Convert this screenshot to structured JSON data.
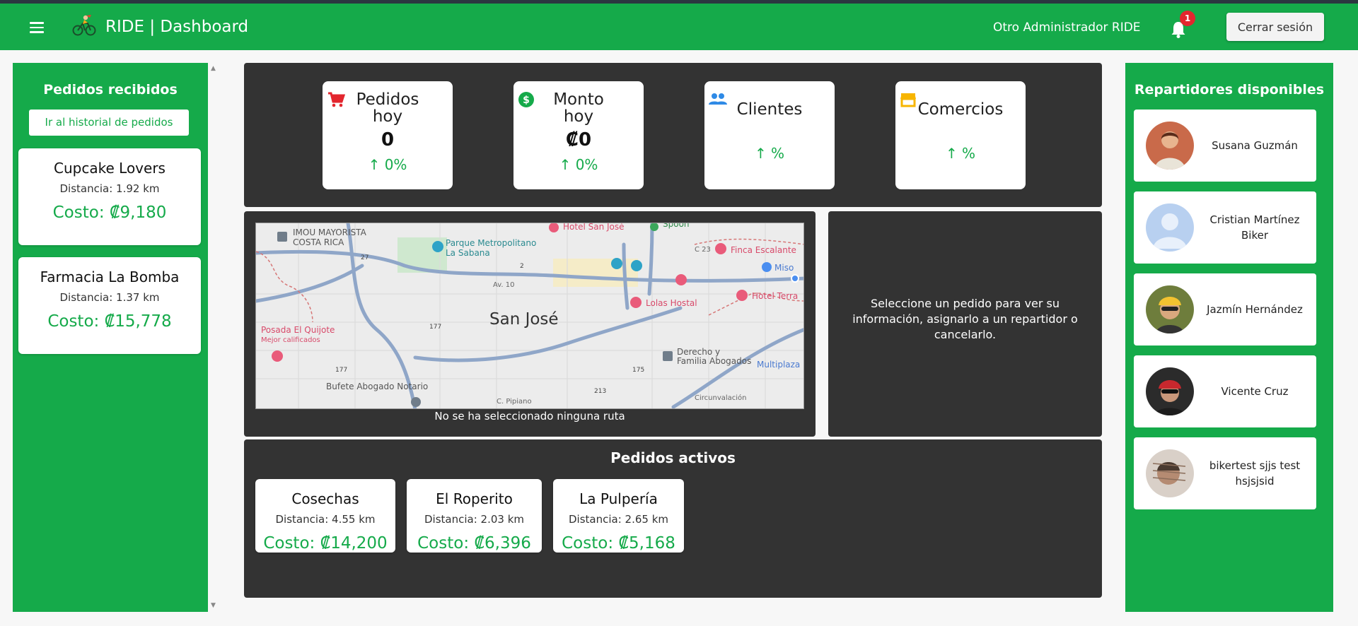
{
  "header": {
    "title": "RIDE | Dashboard",
    "admin_name": "Otro Administrador RIDE",
    "notification_count": "1",
    "logout_label": "Cerrar sesión",
    "bar_color": "#15aa4a"
  },
  "received": {
    "title": "Pedidos recibidos",
    "history_button": "Ir al historial de pedidos",
    "orders": [
      {
        "name": "Cupcake Lovers",
        "distance": "Distancia: 1.92 km",
        "cost": "Costo: ₡9,180"
      },
      {
        "name": "Farmacia La Bomba",
        "distance": "Distancia: 1.37 km",
        "cost": "Costo: ₡15,778"
      }
    ]
  },
  "stats": [
    {
      "title_line1": "Pedidos",
      "title_line2": "hoy",
      "value": "0",
      "change": "↑ 0%",
      "icon": "cart-icon"
    },
    {
      "title_line1": "Monto",
      "title_line2": "hoy",
      "value": "₡0",
      "change": "↑ 0%",
      "icon": "dollar-icon"
    },
    {
      "title_line1": "Clientes",
      "title_line2": "",
      "value": "",
      "change": "↑ %",
      "icon": "people-icon"
    },
    {
      "title_line1": "Comercios",
      "title_line2": "",
      "value": "",
      "change": "↑ %",
      "icon": "store-icon"
    }
  ],
  "map": {
    "city": "San José",
    "caption": "No se ha seleccionado ninguna ruta",
    "labels": {
      "imou": "IMOU MAYORISTA",
      "costa_rica": "COSTA RICA",
      "parque1": "Parque Metropolitano",
      "parque2": "La Sabana",
      "hotel_sj": "Hotel San José",
      "spoon": "Spoon",
      "finca": "Finca Escalante",
      "lolas": "Lolas Hostal",
      "hotel_terra": "Hotel Terra",
      "posada": "Posada El Quijote",
      "mejor": "Mejor calificados",
      "derecho1": "Derecho y",
      "derecho2": "Familia Abogados",
      "bufete": "Bufete Abogado Notario",
      "multiplaza": "Multiplaza",
      "miso": "Miso",
      "av10": "Av. 10",
      "c23": "C 23",
      "cpipiano": "C. Pipiano",
      "circunvalacion": "Circunvalación",
      "r27": "27",
      "r2": "2",
      "r177a": "177",
      "r177b": "177",
      "r175": "175",
      "r213": "213"
    }
  },
  "info": {
    "text": "Seleccione un pedido para ver su información, asignarlo a un repartidor o cancelarlo."
  },
  "active": {
    "title": "Pedidos activos",
    "orders": [
      {
        "name": "Cosechas",
        "distance": "Distancia: 4.55 km",
        "cost": "Costo: ₡14,200"
      },
      {
        "name": "El Roperito",
        "distance": "Distancia: 2.03 km",
        "cost": "Costo: ₡6,396"
      },
      {
        "name": "La Pulpería",
        "distance": "Distancia: 2.65 km",
        "cost": "Costo: ₡5,168"
      }
    ]
  },
  "couriers": {
    "title": "Repartidores disponibles",
    "items": [
      {
        "name": "Susana Guzmán"
      },
      {
        "name": "Cristian Martínez Biker"
      },
      {
        "name": "Jazmín Hernández"
      },
      {
        "name": "Vicente Cruz"
      },
      {
        "name": "bikertest sjjs test hsjsjsid"
      }
    ]
  }
}
